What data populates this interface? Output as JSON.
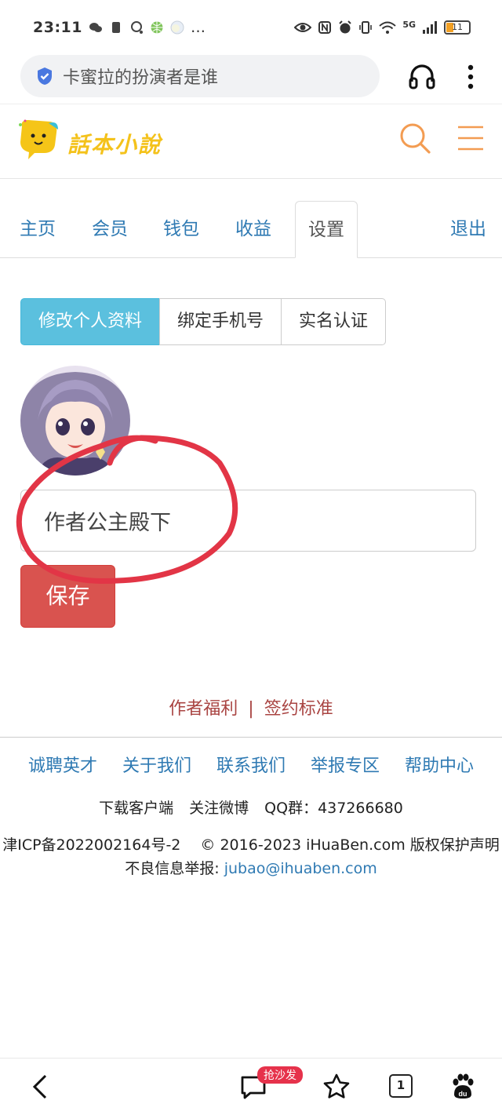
{
  "status_bar": {
    "time": "23:11",
    "ellipsis": "…",
    "network": "5G",
    "battery": "11"
  },
  "browser": {
    "url_text": "卡蜜拉的扮演者是谁"
  },
  "site": {
    "logo_text": "話本小說",
    "accent": "#f39c52"
  },
  "tabs": [
    {
      "label": "主页"
    },
    {
      "label": "会员"
    },
    {
      "label": "钱包"
    },
    {
      "label": "收益"
    },
    {
      "label": "设置"
    },
    {
      "label": "退出"
    }
  ],
  "subtabs": [
    {
      "label": "修改个人资料"
    },
    {
      "label": "绑定手机号"
    },
    {
      "label": "实名认证"
    }
  ],
  "profile": {
    "name_value": "作者公主殿下",
    "save_label": "保存"
  },
  "welfare": {
    "left": "作者福利",
    "separator": "|",
    "right": "签约标准"
  },
  "footer": {
    "links": [
      {
        "label": "诚聘英才"
      },
      {
        "label": "关于我们"
      },
      {
        "label": "联系我们"
      },
      {
        "label": "举报专区"
      },
      {
        "label": "帮助中心"
      }
    ],
    "download": "下载客户端",
    "weibo": "关注微博",
    "qq": "QQ群：437266680",
    "legal": "津ICP备2022002164号-2　 © 2016-2023 iHuaBen.com 版权保护声明　不良信息举报: ",
    "email": "jubao@ihuaben.com"
  },
  "bottom_bar": {
    "comment_badge": "抢沙发",
    "tab_count": "1"
  },
  "colors": {
    "link": "#2f7ab3",
    "subtab_active": "#5bc0de",
    "save": "#d9534f",
    "welfare": "#a94442",
    "annotation": "#e23546"
  }
}
